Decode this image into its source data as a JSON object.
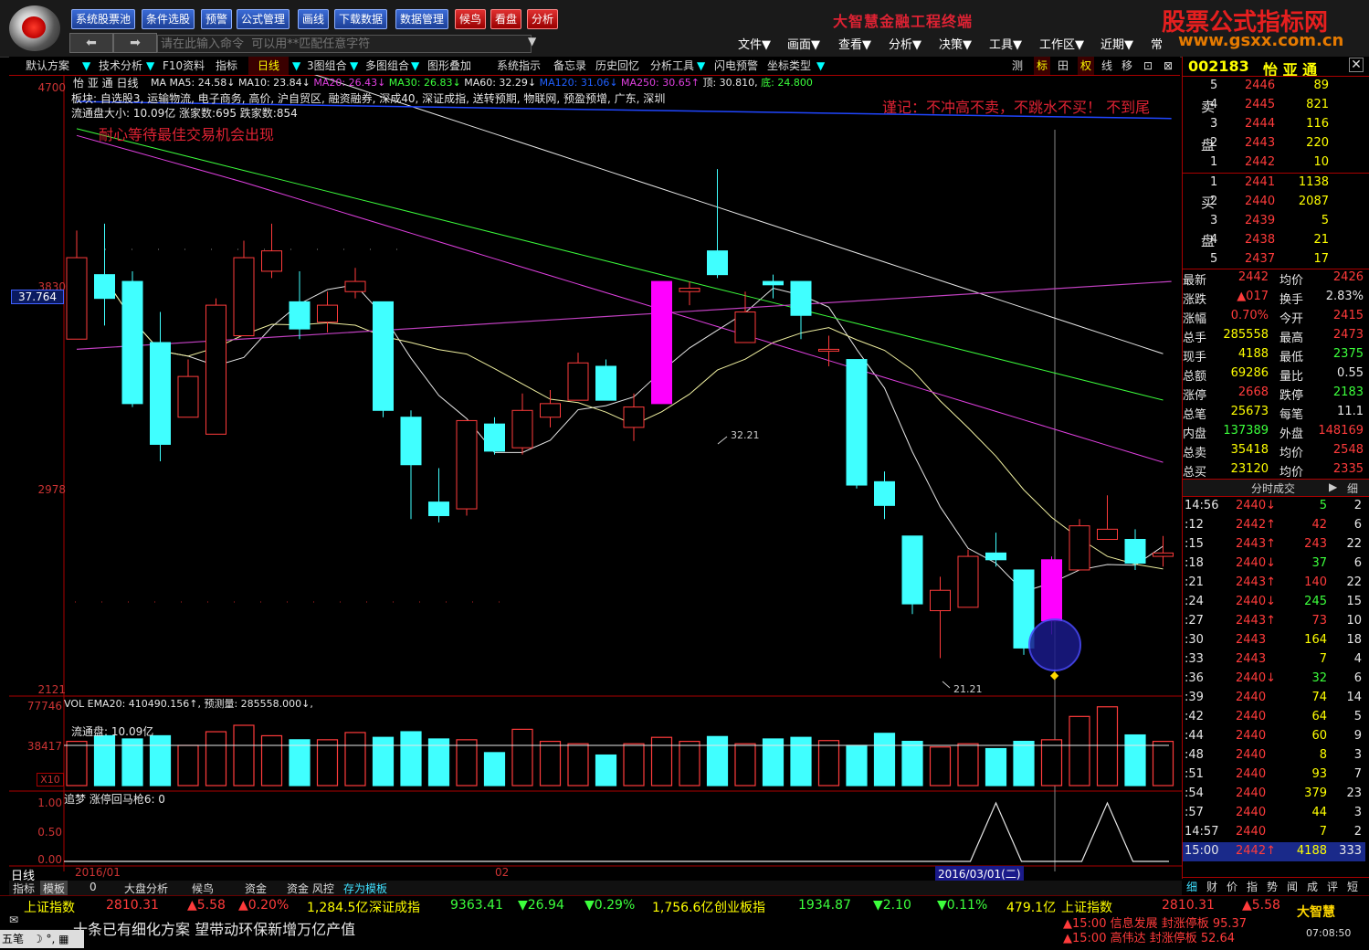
{
  "toolbar": {
    "buttons": [
      "系统股票池",
      "条件选股",
      "预警",
      "公式管理",
      "画线",
      "下载数据",
      "数据管理"
    ],
    "red_buttons": [
      "候鸟",
      "看盘",
      "分析"
    ],
    "app_title": "大智慧金融工程终端",
    "command_placeholder": "请在此输入命令  可以用**匹配任意字符",
    "menus": [
      "文件▼",
      "画面▼",
      "查看▼",
      "分析▼",
      "决策▼",
      "工具▼",
      "工作区▼",
      "近期▼",
      "常"
    ]
  },
  "watermark": {
    "cn": "股票公式指标网",
    "url": "www.gsxx.com.cn"
  },
  "bar2": {
    "items": [
      "默认方案",
      "▼",
      "技术分析",
      "▼",
      "F10资料",
      "指标",
      "日线",
      "▼",
      "3图组合",
      "▼",
      "多图组合",
      "▼",
      "图形叠加",
      "系统指示",
      "备忘录",
      "历史回忆",
      "分析工具",
      "▼",
      "闪电预警",
      "坐标类型",
      "▼"
    ],
    "right_items": [
      "测",
      "标",
      "田",
      "权",
      "线",
      "移",
      "⊡",
      "⊠"
    ]
  },
  "chart_info": {
    "stock_line": "怡 亚 通 日线",
    "ma_line": [
      {
        "text": "MA MA5: 24.58↓",
        "color": "#e6e6e6"
      },
      {
        "text": "MA10: 23.84↓",
        "color": "#e6e6e6"
      },
      {
        "text": "MA20: 26.43↓",
        "color": "#e040e0"
      },
      {
        "text": "MA30: 26.83↓",
        "color": "#3cff3c"
      },
      {
        "text": "MA60: 32.29↓",
        "color": "#e6e6e6"
      },
      {
        "text": "MA120: 31.06↓",
        "color": "#2060ff"
      },
      {
        "text": "MA250: 30.65↑",
        "color": "#e040e0"
      },
      {
        "text": "顶: 30.810,",
        "color": "#e6e6e6"
      },
      {
        "text": "底: 24.800",
        "color": "#3cff3c"
      }
    ],
    "sector_line": "板块: 自选股3, 运输物流, 电子商务, 高价, 沪自贸区, 融资融券, 深成40, 深证成指, 送转预期, 物联网, 预盈预增, 广东, 深圳",
    "float_line": "流通盘大小: 10.09亿  涨家数:695  跌家数:854",
    "advice": "耐心等待最佳交易机会出现",
    "warning": "谨记：不冲高不卖，不跳水不买！  不到尾",
    "current_price_label": "37.764",
    "y_labels": [
      "4700",
      "3830",
      "2978",
      "2121"
    ],
    "high_label": "32.21",
    "low_label": "21.21",
    "vol_line": "VOL EMA20: 410490.156↑, 预测量: 285558.000↓,",
    "vol_float": "流通盘: 10.09亿",
    "vol_labels": [
      "77746",
      "38417",
      "X10"
    ],
    "ind_line": "追梦  涨停回马枪6: 0",
    "ind_labels": [
      "1.00",
      "0.50",
      "0.00"
    ],
    "date_labels": [
      "2016/01",
      "02",
      "2016/03/01(二)"
    ],
    "period_label": "日线"
  },
  "chart_data": {
    "type": "candlestick",
    "candles": [
      {
        "o": 27.2,
        "c": 29.6,
        "h": 30.4,
        "l": 27.2
      },
      {
        "o": 29.1,
        "c": 28.4,
        "h": 30.6,
        "l": 27.6
      },
      {
        "o": 28.9,
        "c": 25.3,
        "h": 29.2,
        "l": 25.2
      },
      {
        "o": 27.1,
        "c": 24.1,
        "h": 28.0,
        "l": 23.6
      },
      {
        "o": 24.9,
        "c": 26.1,
        "h": 26.6,
        "l": 24.9
      },
      {
        "o": 24.4,
        "c": 28.2,
        "h": 28.4,
        "l": 24.4
      },
      {
        "o": 27.3,
        "c": 29.6,
        "h": 30.1,
        "l": 27.3
      },
      {
        "o": 29.2,
        "c": 29.8,
        "h": 30.6,
        "l": 29.0
      },
      {
        "o": 28.3,
        "c": 27.5,
        "h": 29.2,
        "l": 27.2
      },
      {
        "o": 27.7,
        "c": 28.2,
        "h": 28.6,
        "l": 27.4
      },
      {
        "o": 28.6,
        "c": 28.9,
        "h": 29.3,
        "l": 28.4
      },
      {
        "o": 28.3,
        "c": 25.1,
        "h": 28.3,
        "l": 24.9
      },
      {
        "o": 24.9,
        "c": 23.5,
        "h": 25.1,
        "l": 21.9
      },
      {
        "o": 22.4,
        "c": 22.0,
        "h": 23.4,
        "l": 21.8
      },
      {
        "o": 22.2,
        "c": 24.8,
        "h": 24.8,
        "l": 22.0
      },
      {
        "o": 24.7,
        "c": 23.9,
        "h": 24.9,
        "l": 23.8
      },
      {
        "o": 24.0,
        "c": 25.1,
        "h": 25.6,
        "l": 23.8
      },
      {
        "o": 24.9,
        "c": 25.3,
        "h": 25.7,
        "l": 24.6
      },
      {
        "o": 25.4,
        "c": 26.5,
        "h": 26.8,
        "l": 25.4
      },
      {
        "o": 26.4,
        "c": 25.4,
        "h": 26.6,
        "l": 25.4
      },
      {
        "o": 24.6,
        "c": 25.2,
        "h": 25.6,
        "l": 24.2
      },
      {
        "o": 25.3,
        "c": 28.9,
        "h": 28.9,
        "l": 25.3
      },
      {
        "o": 28.6,
        "c": 28.7,
        "h": 28.9,
        "l": 28.2
      },
      {
        "o": 29.8,
        "c": 29.1,
        "h": 32.21,
        "l": 29.0
      },
      {
        "o": 27.1,
        "c": 28.0,
        "h": 28.6,
        "l": 27.1
      },
      {
        "o": 28.9,
        "c": 28.8,
        "h": 29.1,
        "l": 28.4
      },
      {
        "o": 28.9,
        "c": 27.9,
        "h": 28.9,
        "l": 27.2
      },
      {
        "o": 26.9,
        "c": 26.9,
        "h": 27.3,
        "l": 26.4
      },
      {
        "o": 26.6,
        "c": 22.9,
        "h": 26.6,
        "l": 22.8
      },
      {
        "o": 23.0,
        "c": 22.3,
        "h": 23.3,
        "l": 21.9
      },
      {
        "o": 21.4,
        "c": 19.4,
        "h": 21.4,
        "l": 19.1
      },
      {
        "o": 19.2,
        "c": 19.8,
        "h": 20.2,
        "l": 17.8
      },
      {
        "o": 19.3,
        "c": 20.8,
        "h": 21.0,
        "l": 19.3
      },
      {
        "o": 20.9,
        "c": 20.7,
        "h": 21.5,
        "l": 20.5
      },
      {
        "o": 20.4,
        "c": 18.1,
        "h": 20.4,
        "l": 17.9
      },
      {
        "o": 18.9,
        "c": 20.7,
        "h": 20.8,
        "l": 18.5
      },
      {
        "o": 20.4,
        "c": 21.7,
        "h": 21.9,
        "l": 20.4
      },
      {
        "o": 21.3,
        "c": 21.6,
        "h": 22.6,
        "l": 21.3
      },
      {
        "o": 21.3,
        "c": 20.6,
        "h": 21.6,
        "l": 20.4
      },
      {
        "o": 20.8,
        "c": 20.9,
        "h": 21.4,
        "l": 20.5
      }
    ],
    "volumes": [
      0.55,
      0.62,
      0.58,
      0.62,
      0.5,
      0.67,
      0.75,
      0.62,
      0.57,
      0.57,
      0.66,
      0.6,
      0.67,
      0.58,
      0.57,
      0.41,
      0.7,
      0.55,
      0.52,
      0.38,
      0.52,
      0.6,
      0.55,
      0.61,
      0.52,
      0.58,
      0.6,
      0.56,
      0.5,
      0.65,
      0.55,
      0.48,
      0.52,
      0.46,
      0.55,
      0.57,
      0.86,
      0.98,
      0.63,
      0.55
    ],
    "signal_peaks": [
      33,
      37
    ],
    "ylim": [
      16.9,
      34.5
    ]
  },
  "order_book": {
    "sell": [
      {
        "lv": "5",
        "p": "2446",
        "v": "89"
      },
      {
        "lv": "4",
        "p": "2445",
        "v": "821"
      },
      {
        "lv": "3",
        "p": "2444",
        "v": "116"
      },
      {
        "lv": "2",
        "p": "2443",
        "v": "220"
      },
      {
        "lv": "1",
        "p": "2442",
        "v": "10"
      }
    ],
    "buy": [
      {
        "lv": "1",
        "p": "2441",
        "v": "1138"
      },
      {
        "lv": "2",
        "p": "2440",
        "v": "2087"
      },
      {
        "lv": "3",
        "p": "2439",
        "v": "5"
      },
      {
        "lv": "4",
        "p": "2438",
        "v": "21"
      },
      {
        "lv": "5",
        "p": "2437",
        "v": "17"
      }
    ],
    "sell_label": [
      "卖",
      "盘"
    ],
    "buy_label": [
      "买",
      "盘"
    ]
  },
  "stats": [
    {
      "l1": "最新",
      "v1": "2442",
      "l2": "均价",
      "v2": "2426"
    },
    {
      "l1": "涨跌",
      "v1": "▲017",
      "l2": "换手",
      "v2": "2.83%"
    },
    {
      "l1": "涨幅",
      "v1": "0.70%",
      "l2": "今开",
      "v2": "2415"
    },
    {
      "l1": "总手",
      "v1": "285558",
      "l2": "最高",
      "v2": "2473"
    },
    {
      "l1": "现手",
      "v1": "4188",
      "l2": "最低",
      "v2": "2375"
    },
    {
      "l1": "总额",
      "v1": "69286",
      "l2": "量比",
      "v2": "0.55"
    },
    {
      "l1": "涨停",
      "v1": "2668",
      "l2": "跌停",
      "v2": "2183"
    },
    {
      "l1": "总笔",
      "v1": "25673",
      "l2": "每笔",
      "v2": "11.1"
    },
    {
      "l1": "内盘",
      "v1": "137389",
      "l2": "外盘",
      "v2": "148169"
    },
    {
      "l1": "总卖",
      "v1": "35418",
      "l2": "均价",
      "v2": "2548"
    },
    {
      "l1": "总买",
      "v1": "23120",
      "l2": "均价",
      "v2": "2335"
    }
  ],
  "stock_header": {
    "code": "002183",
    "name": "怡 亚 通"
  },
  "ticks_header": {
    "title": "分时成交",
    "btn": "细"
  },
  "ticks": [
    {
      "t": "14:56",
      "p": "2440↓",
      "v": "5",
      "n": "2"
    },
    {
      "t": ":12",
      "p": "2442↑",
      "v": "42",
      "n": "6"
    },
    {
      "t": ":15",
      "p": "2443↑",
      "v": "243",
      "n": "22"
    },
    {
      "t": ":18",
      "p": "2440↓",
      "v": "37",
      "n": "6"
    },
    {
      "t": ":21",
      "p": "2443↑",
      "v": "140",
      "n": "22"
    },
    {
      "t": ":24",
      "p": "2440↓",
      "v": "245",
      "n": "15"
    },
    {
      "t": ":27",
      "p": "2443↑",
      "v": "73",
      "n": "10"
    },
    {
      "t": ":30",
      "p": "2443",
      "v": "164",
      "n": "18"
    },
    {
      "t": ":33",
      "p": "2443",
      "v": "7",
      "n": "4"
    },
    {
      "t": ":36",
      "p": "2440↓",
      "v": "32",
      "n": "6"
    },
    {
      "t": ":39",
      "p": "2440",
      "v": "74",
      "n": "14"
    },
    {
      "t": ":42",
      "p": "2440",
      "v": "64",
      "n": "5"
    },
    {
      "t": ":44",
      "p": "2440",
      "v": "60",
      "n": "9"
    },
    {
      "t": ":48",
      "p": "2440",
      "v": "8",
      "n": "3"
    },
    {
      "t": ":51",
      "p": "2440",
      "v": "93",
      "n": "7"
    },
    {
      "t": ":54",
      "p": "2440",
      "v": "379",
      "n": "23"
    },
    {
      "t": ":57",
      "p": "2440",
      "v": "44",
      "n": "3"
    },
    {
      "t": "14:57",
      "p": "2440",
      "v": "7",
      "n": "2"
    },
    {
      "t": "15:00",
      "p": "2442↑",
      "v": "4188",
      "n": "333"
    }
  ],
  "right_tabs": [
    "细",
    "财",
    "价",
    "指",
    "势",
    "闻",
    "成",
    "评",
    "短"
  ],
  "bottom_tabs": [
    "指标",
    "模板",
    "0",
    "大盘分析",
    "候鸟",
    "资金",
    "资金 风控",
    "存为模板"
  ],
  "status": {
    "items": [
      {
        "t": "上证指数",
        "c": "#ffff00"
      },
      {
        "t": "2810.31",
        "c": "#ff3b3b"
      },
      {
        "t": "▲5.58",
        "c": "#ff3b3b"
      },
      {
        "t": "▲0.20%",
        "c": "#ff3b3b"
      },
      {
        "t": "1,284.5亿",
        "c": "#ffff00"
      },
      {
        "t": "深证成指",
        "c": "#ffff00"
      },
      {
        "t": "9363.41",
        "c": "#3cff3c"
      },
      {
        "t": "▼26.94",
        "c": "#3cff3c"
      },
      {
        "t": "▼0.29%",
        "c": "#3cff3c"
      },
      {
        "t": "1,756.6亿",
        "c": "#ffff00"
      },
      {
        "t": "创业板指",
        "c": "#ffff00"
      },
      {
        "t": "1934.87",
        "c": "#3cff3c"
      },
      {
        "t": "▼2.10",
        "c": "#3cff3c"
      },
      {
        "t": "▼0.11%",
        "c": "#3cff3c"
      },
      {
        "t": "479.1亿",
        "c": "#ffff00"
      },
      {
        "t": "上证指数",
        "c": "#ffff00"
      },
      {
        "t": "2810.31",
        "c": "#ff3b3b"
      },
      {
        "t": "▲5.58",
        "c": "#ff3b3b"
      }
    ],
    "news": "十条已有细化方案 望带动环保新增万亿产值",
    "alerts": [
      "▲15:00 信息发展 封涨停板 95.37",
      "▲15:00 高伟达  封涨停板 52.64"
    ],
    "brand": "大智慧",
    "clock": "07:08:50",
    "ime": "五笔"
  }
}
